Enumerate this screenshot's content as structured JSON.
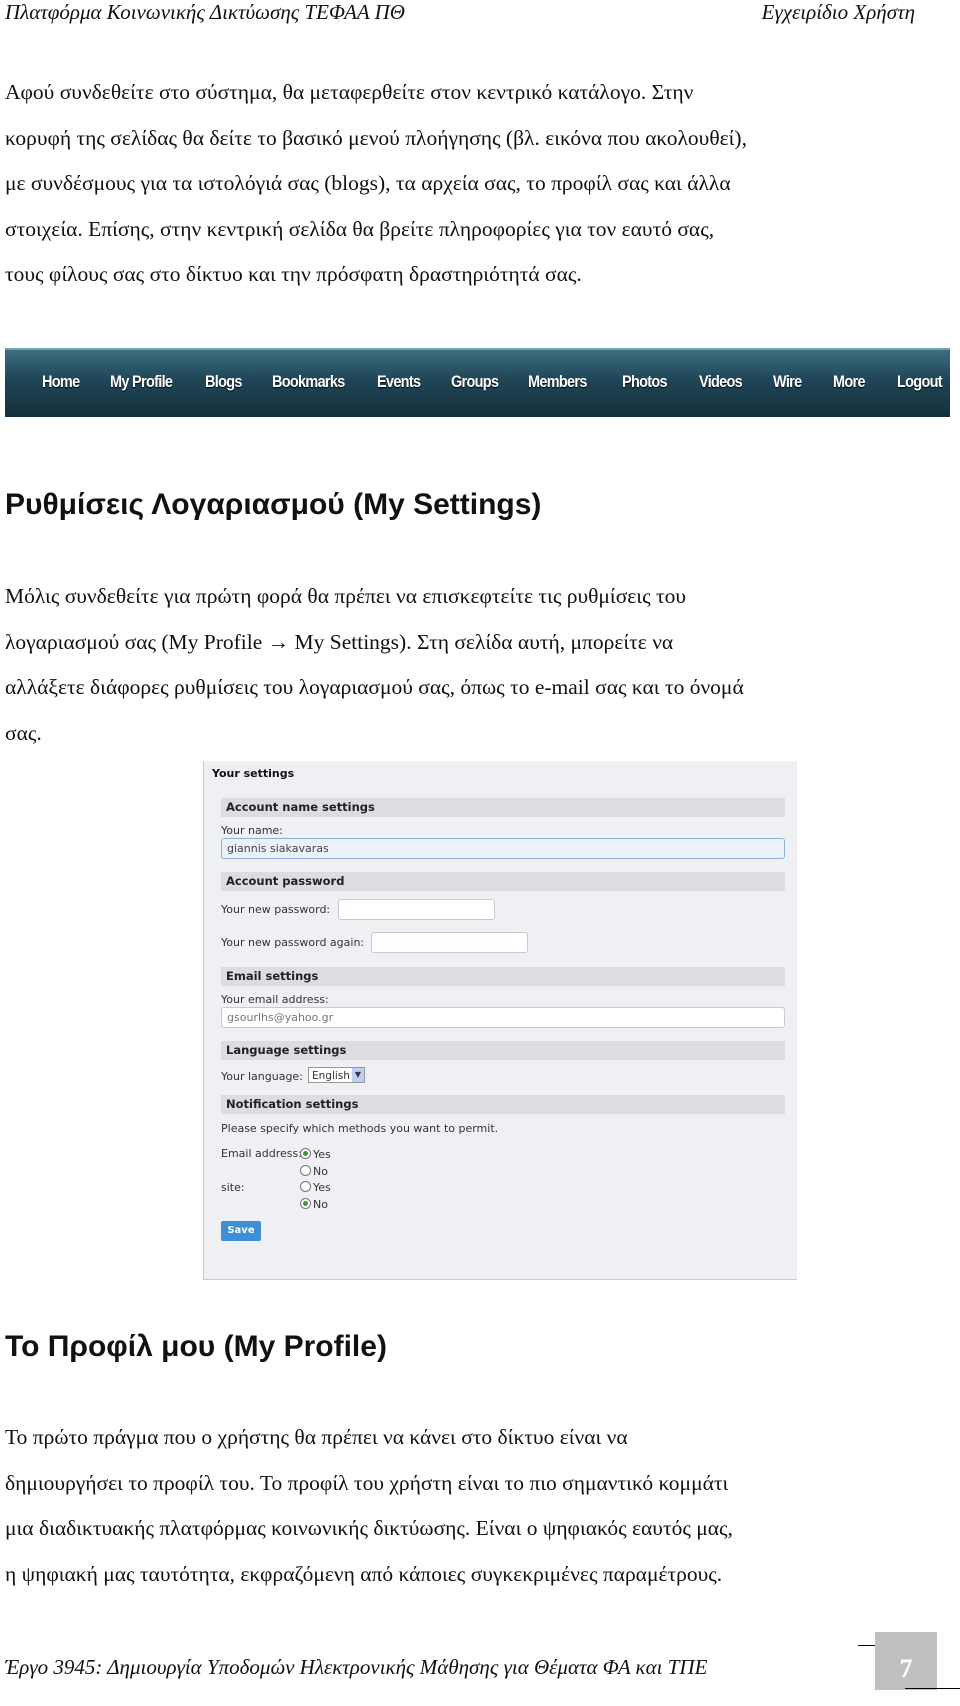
{
  "header": {
    "left": "Πλατφόρμα Κοινωνικής Δικτύωσης ΤΕΦΑΑ ΠΘ",
    "right": "Εγχειρίδιο Χρήστη"
  },
  "intro": {
    "lines": [
      "Αφού συνδεθείτε στο σύστημα, θα μεταφερθείτε στον κεντρικό κατάλογο. Στην",
      "κορυφή της σελίδας θα δείτε το βασικό μενού πλοήγησης (βλ. εικόνα που ακολουθεί),",
      "με συνδέσμους για τα ιστολόγιά σας (blogs), τα αρχεία σας, το προφίλ σας και άλλα",
      "στοιχεία. Επίσης, στην κεντρική σελίδα θα βρείτε πληροφορίες για τον εαυτό σας,",
      "τους φίλους σας στο δίκτυο και την πρόσφατη δραστηριότητά σας."
    ]
  },
  "nav": {
    "items": [
      "Home",
      "My Profile",
      "Blogs",
      "Bookmarks",
      "Events",
      "Groups",
      "Members",
      "Photos",
      "Videos",
      "Wire",
      "More",
      "Logout"
    ]
  },
  "section1": {
    "title": "Ρυθμίσεις Λογαριασμού (My Settings)",
    "lines": [
      "Μόλις συνδεθείτε για πρώτη φορά θα πρέπει να επισκεφτείτε τις ρυθμίσεις του",
      "λογαριασμού σας (My Profile → My Settings). Στη σελίδα αυτή, μπορείτε να",
      "αλλάξετε διάφορες ρυθμίσεις του λογαριασμού σας, όπως το e-mail σας και το όνομά",
      "σας."
    ]
  },
  "settings": {
    "title": "Your settings",
    "account_name": {
      "heading": "Account name settings",
      "label": "Your name:",
      "value": "giannis siakavaras"
    },
    "password": {
      "heading": "Account password",
      "label1": "Your new password:",
      "label2": "Your new password again:"
    },
    "email": {
      "heading": "Email settings",
      "label": "Your email address:",
      "value": "gsourlhs@yahoo.gr"
    },
    "language": {
      "heading": "Language settings",
      "label": "Your language:",
      "value": "English"
    },
    "notification": {
      "heading": "Notification settings",
      "text": "Please specify which methods you want to permit.",
      "email_label": "Email address:",
      "email_yes": "Yes",
      "email_no": "No",
      "site_label": "site:",
      "site_yes": "Yes",
      "site_no": "No",
      "email_selected": "Yes",
      "site_selected": "No"
    },
    "save_label": "Save",
    "accent": "#3f8fd6"
  },
  "section2": {
    "title": "Το Προφίλ μου (My Profile)",
    "lines": [
      "Το πρώτο πράγμα που ο χρήστης θα πρέπει να κάνει στο δίκτυο είναι να",
      "δημιουργήσει το προφίλ του. Το προφίλ του χρήστη είναι το πιο σημαντικό κομμάτι",
      "μια διαδικτυακής πλατφόρμας κοινωνικής δικτύωσης. Είναι ο ψηφιακός εαυτός μας,",
      "η ψηφιακή μας ταυτότητα, εκφραζόμενη από κάποιες συγκεκριμένες παραμέτρους."
    ]
  },
  "footer": {
    "text": "Έργο 3945: Δημιουργία Υποδομών Ηλεκτρονικής Μάθησης για Θέματα ΦΑ και ΤΠΕ",
    "page": "7"
  }
}
